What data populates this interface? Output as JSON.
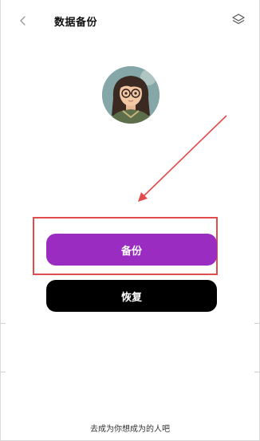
{
  "header": {
    "title": "数据备份",
    "back_icon": "chevron-left-icon",
    "right_icon": "layers-icon"
  },
  "avatar": {
    "description": "profile-avatar"
  },
  "buttons": {
    "backup_label": "备份",
    "restore_label": "恢复"
  },
  "footer": {
    "slogan": "去成为你想成为的人吧"
  },
  "colors": {
    "accent": "#9b2cc1",
    "restore": "#000000",
    "annotation": "#e24b4b"
  }
}
